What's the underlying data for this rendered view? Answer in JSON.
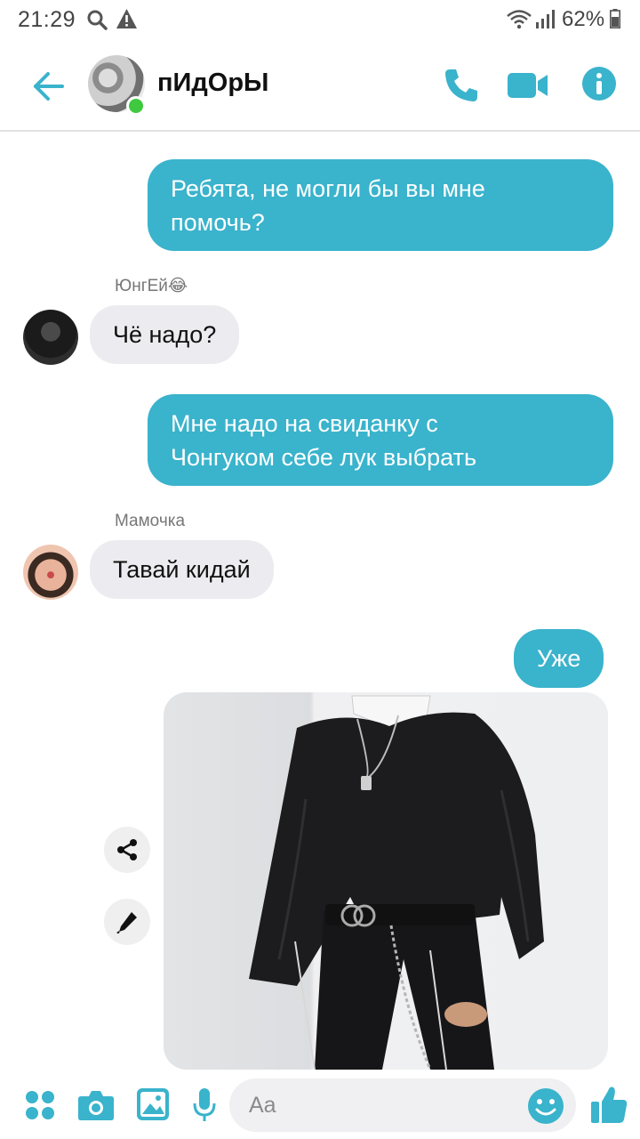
{
  "status_bar": {
    "time": "21:29",
    "battery": "62%",
    "icons": [
      "search-icon",
      "warning-icon",
      "wifi-icon",
      "signal-icon",
      "battery-icon"
    ]
  },
  "header": {
    "title": "пИдОрЫ",
    "online": true,
    "accent_color": "#3ab3cc",
    "icons": [
      "back-arrow-icon",
      "phone-icon",
      "video-camera-icon",
      "info-icon"
    ]
  },
  "messages": [
    {
      "direction": "out",
      "lines": [
        "Ребята, не могли бы вы мне",
        "помочь?"
      ]
    },
    {
      "direction": "in",
      "sender": "ЮнгЕй😂",
      "text": "Чё надо?"
    },
    {
      "direction": "out",
      "lines": [
        "Мне надо на свиданку с",
        "Чонгуком себе лук выбрать"
      ]
    },
    {
      "direction": "in",
      "sender": "Мамочка",
      "text": "Тавай кидай"
    },
    {
      "direction": "out",
      "text": "Уже"
    },
    {
      "direction": "out",
      "type": "photo",
      "image": "outfit-photo",
      "actions": [
        "share-icon",
        "edit-pen-icon"
      ]
    }
  ],
  "composer": {
    "placeholder": "Aa",
    "icons": [
      "apps-grid-icon",
      "camera-icon",
      "gallery-icon",
      "microphone-icon",
      "emoji-icon",
      "thumbs-up-icon"
    ]
  },
  "colors": {
    "outgoing_bubble": "#3ab3cc",
    "incoming_bubble": "#ececf0",
    "online": "#3ec93e"
  }
}
